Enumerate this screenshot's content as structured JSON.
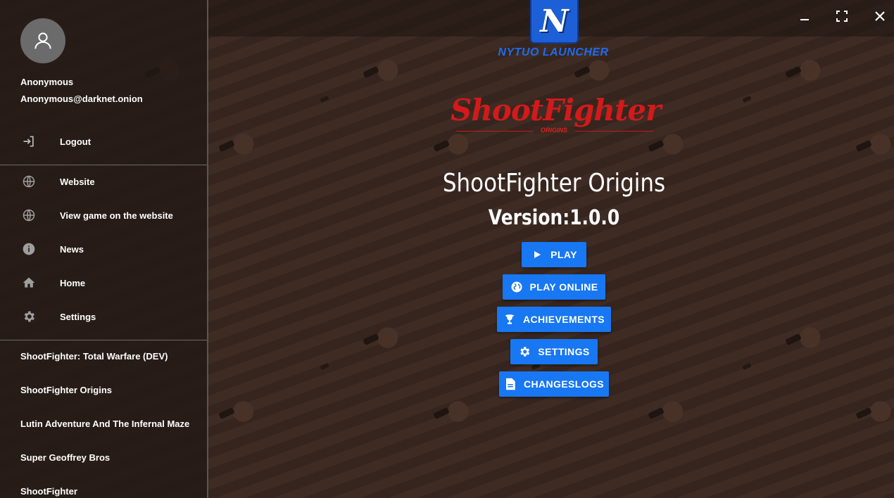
{
  "user": {
    "name": "Anonymous",
    "email": "Anonymous@darknet.onion"
  },
  "sidebar": {
    "logout_label": "Logout",
    "nav": [
      {
        "label": "Website",
        "icon": "globe-icon"
      },
      {
        "label": "View game on the website",
        "icon": "globe-icon"
      },
      {
        "label": "News",
        "icon": "info-icon"
      },
      {
        "label": "Home",
        "icon": "home-icon"
      },
      {
        "label": "Settings",
        "icon": "gear-icon"
      }
    ],
    "games": [
      "ShootFighter: Total Warfare (DEV)",
      "ShootFighter Origins",
      "Lutin Adventure And The Infernal Maze",
      "Super Geoffrey Bros",
      "ShootFighter"
    ]
  },
  "launcher": {
    "logo_letter": "N",
    "name": "NYTUO LAUNCHER"
  },
  "game": {
    "logo_text": "ShootFighter",
    "logo_sub": "ORIGINS",
    "title": "ShootFighter Origins",
    "version": "Version:1.0.0"
  },
  "actions": [
    {
      "label": "PLAY",
      "icon": "play-icon"
    },
    {
      "label": "PLAY ONLINE",
      "icon": "globe-icon"
    },
    {
      "label": "ACHIEVEMENTS",
      "icon": "trophy-icon"
    },
    {
      "label": "SETTINGS",
      "icon": "gear-icon"
    },
    {
      "label": "CHANGESLOGS",
      "icon": "document-icon"
    }
  ],
  "colors": {
    "accent": "#1877f2",
    "launcher_blue": "#1d5fd6",
    "logo_red": "#d21a1a",
    "background": "#3a2820"
  }
}
